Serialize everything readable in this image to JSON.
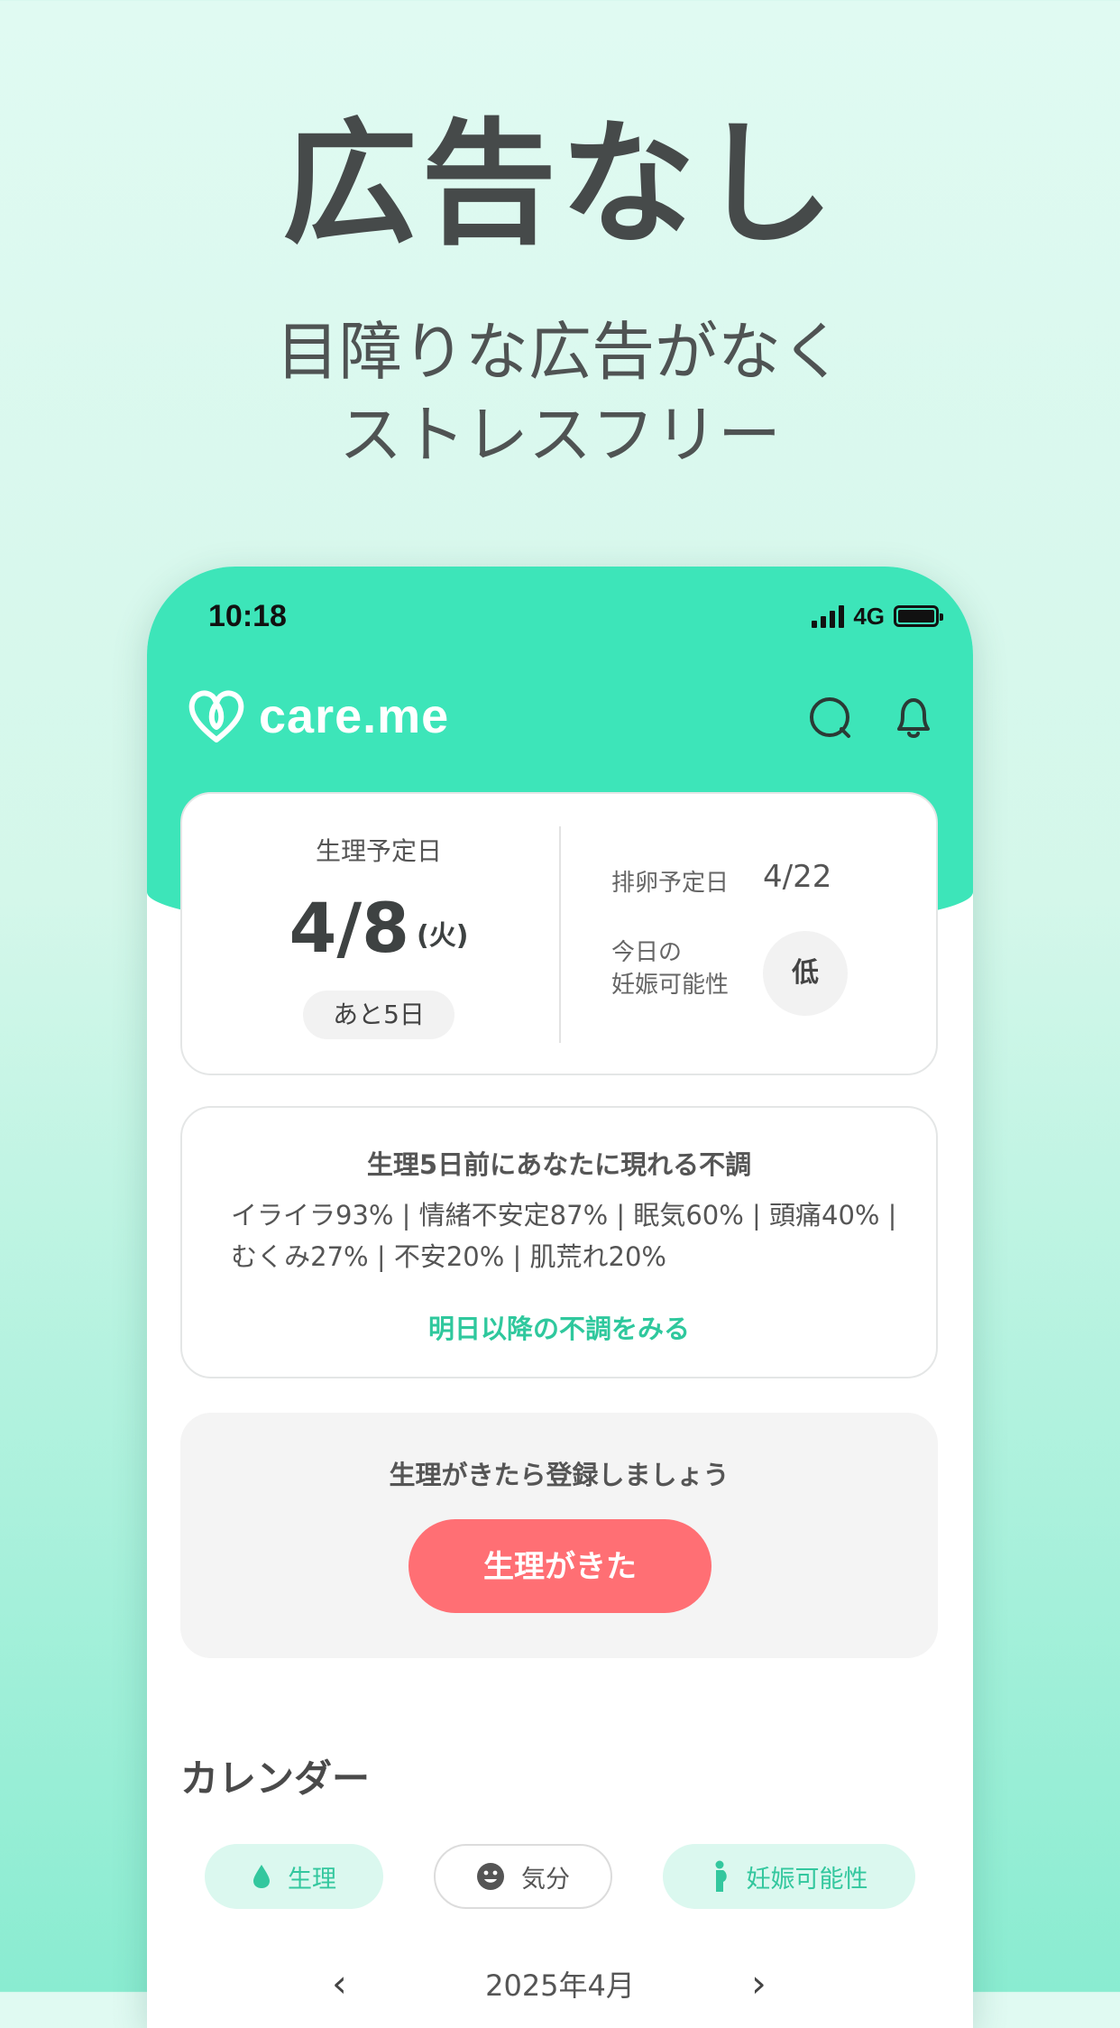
{
  "promo": {
    "headline": "広告なし",
    "sub_line1": "目障りな広告がなく",
    "sub_line2": "ストレスフリー"
  },
  "status_bar": {
    "time": "10:18",
    "network": "4G"
  },
  "header": {
    "app_name": "care.me",
    "icons": [
      "chat-icon",
      "bell-icon"
    ]
  },
  "prediction": {
    "period_label": "生理予定日",
    "period_date": "4/8",
    "period_weekday": "(火)",
    "days_left": "あと5日",
    "ovulation_label": "排卵予定日",
    "ovulation_date": "4/22",
    "pregnancy_label_line1": "今日の",
    "pregnancy_label_line2": "妊娠可能性",
    "pregnancy_level": "低"
  },
  "symptoms": {
    "title": "生理5日前にあなたに現れる不調",
    "body": "イライラ93% | 情緒不安定87% | 眠気60% | 頭痛40% | むくみ27% | 不安20% | 肌荒れ20%",
    "link": "明日以降の不調をみる"
  },
  "register": {
    "prompt": "生理がきたら登録しましょう",
    "button": "生理がきた"
  },
  "calendar": {
    "title": "カレンダー",
    "chips": [
      {
        "label": "生理",
        "icon": "drop-icon"
      },
      {
        "label": "気分",
        "icon": "smiley-icon"
      },
      {
        "label": "妊娠可能性",
        "icon": "pregnant-icon"
      }
    ],
    "month": "2025年4月"
  },
  "colors": {
    "brand_mint": "#3de5b9",
    "accent_red": "#ff6f74",
    "link_green": "#2fc89d"
  }
}
